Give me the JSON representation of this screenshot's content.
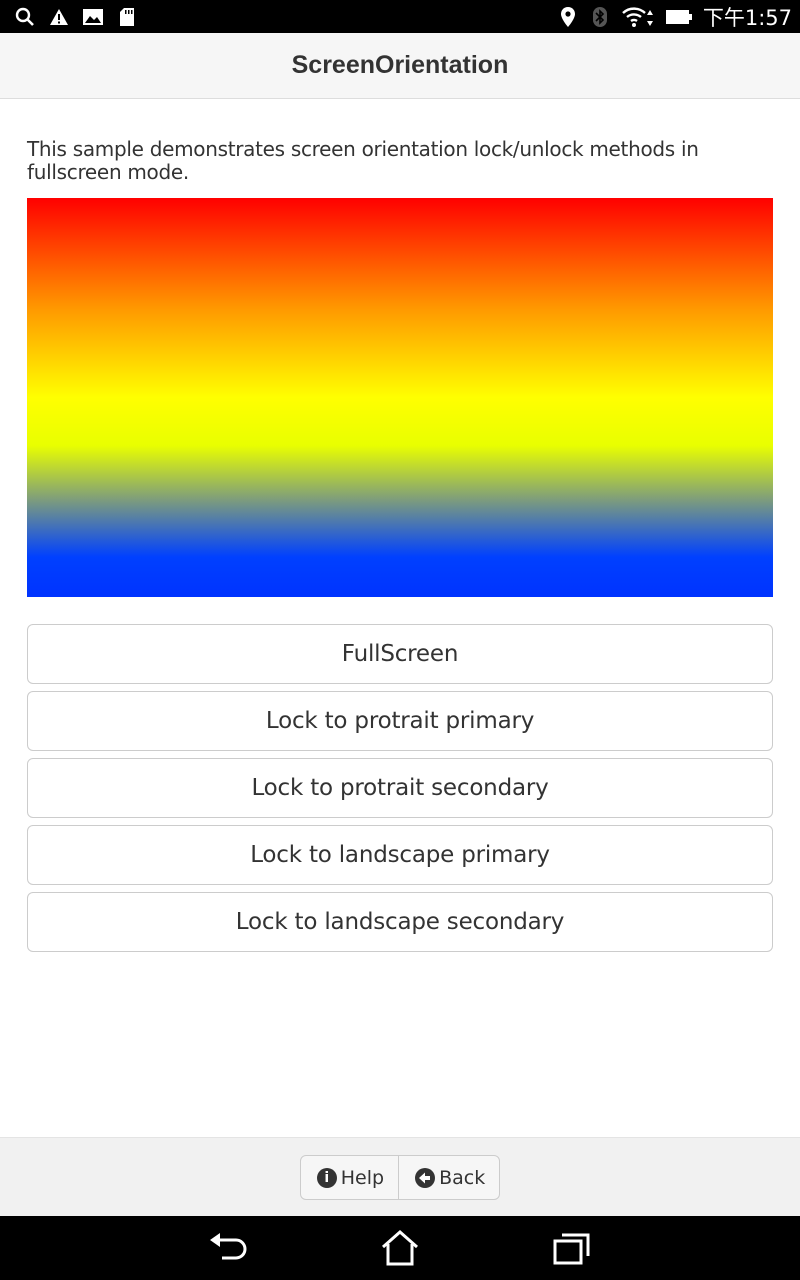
{
  "status_bar": {
    "time": "下午1:57",
    "left_icons": [
      "search-icon",
      "warning-icon",
      "image-icon",
      "sd-card-icon"
    ],
    "right_icons": [
      "location-icon",
      "bluetooth-icon",
      "wifi-icon",
      "battery-icon"
    ]
  },
  "header": {
    "title": "ScreenOrientation"
  },
  "main": {
    "description": "This sample demonstrates screen orientation lock/unlock methods in fullscreen mode.",
    "gradient_colors": [
      "#ff0000",
      "#ff9a00",
      "#ffff00",
      "#e9ff00",
      "#7a9a80",
      "#0040ff"
    ],
    "buttons": [
      {
        "label": "FullScreen"
      },
      {
        "label": "Lock to protrait primary"
      },
      {
        "label": "Lock to protrait secondary"
      },
      {
        "label": "Lock to landscape primary"
      },
      {
        "label": "Lock to landscape secondary"
      }
    ]
  },
  "footer": {
    "help_label": "Help",
    "back_label": "Back",
    "help_icon": "info-icon",
    "back_icon": "arrow-left-circle-icon"
  },
  "nav_bar": {
    "icons": [
      "back-nav-icon",
      "home-nav-icon",
      "recent-apps-icon"
    ]
  }
}
